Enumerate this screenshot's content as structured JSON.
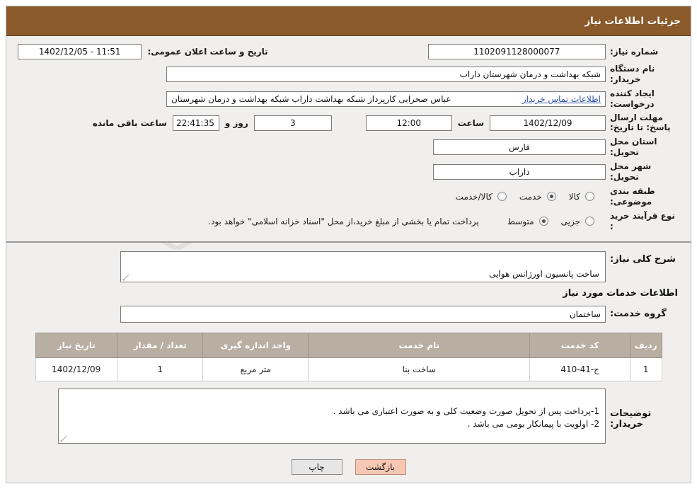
{
  "header": {
    "title": "جزئیات اطلاعات نیاز"
  },
  "watermark": {
    "text": "AriaTender.net"
  },
  "info": {
    "need_number_label": "شماره نیاز:",
    "need_number_value": "1102091128000077",
    "announce_datetime_label": "تاریخ و ساعت اعلان عمومی:",
    "announce_datetime_value": "11:51 - 1402/12/05",
    "buyer_org_label": "نام دستگاه خریدار:",
    "buyer_org_value": "شبکه بهداشت و درمان شهرستان داراب",
    "requester_label": "ایجاد کننده درخواست:",
    "requester_value": "عباس صحرایی کارپرداز شبکه بهداشت داراب شبکه بهداشت و درمان شهرستان",
    "contact_link": "اطلاعات تماس خریدار",
    "deadline_label": "مهلت ارسال پاسخ: تا تاریخ:",
    "deadline_date": "1402/12/09",
    "hour_label": "ساعت",
    "deadline_time": "12:00",
    "days_value": "3",
    "days_label": "روز و",
    "remaining_time": "22:41:35",
    "remaining_label": "ساعت باقی مانده",
    "province_label": "استان محل تحویل:",
    "province_value": "فارس",
    "city_label": "شهر محل تحویل:",
    "city_value": "داراب",
    "category_label": "طبقه بندی موضوعی:",
    "category_options": [
      "کالا",
      "خدمت",
      "کالا/خدمت"
    ],
    "category_selected": "خدمت",
    "process_label": "نوع فرآیند خرید :",
    "process_options": [
      "جزیی",
      "متوسط"
    ],
    "process_selected": "متوسط",
    "process_note": "پرداخت تمام یا بخشی از مبلغ خرید،از محل \"اسناد خزانه اسلامی\" خواهد بود."
  },
  "body": {
    "general_desc_label": "شرح کلی نیاز:",
    "general_desc_value": "ساخت پانسیون اورژانس هوایی",
    "services_section_title": "اطلاعات خدمات مورد نیاز",
    "service_group_label": "گروه خدمت:",
    "service_group_value": "ساختمان",
    "buyer_notes_label": "توضیحات خریدار:",
    "buyer_notes_value": "1-پرداخت پس از تحویل صورت وضعیت کلی و به صورت اعتباری می باشد .\n2- اولویت با پیمانکار بومی می باشد ."
  },
  "table": {
    "columns": [
      "ردیف",
      "کد خدمت",
      "نام خدمت",
      "واحد اندازه گیری",
      "تعداد / مقدار",
      "تاریخ نیاز"
    ],
    "rows": [
      {
        "row": "1",
        "code": "ج-41-410",
        "name": "ساخت بنا",
        "unit": "متر مربع",
        "qty": "1",
        "date": "1402/12/09"
      }
    ]
  },
  "footer": {
    "print_label": "چاپ",
    "back_label": "بازگشت"
  }
}
